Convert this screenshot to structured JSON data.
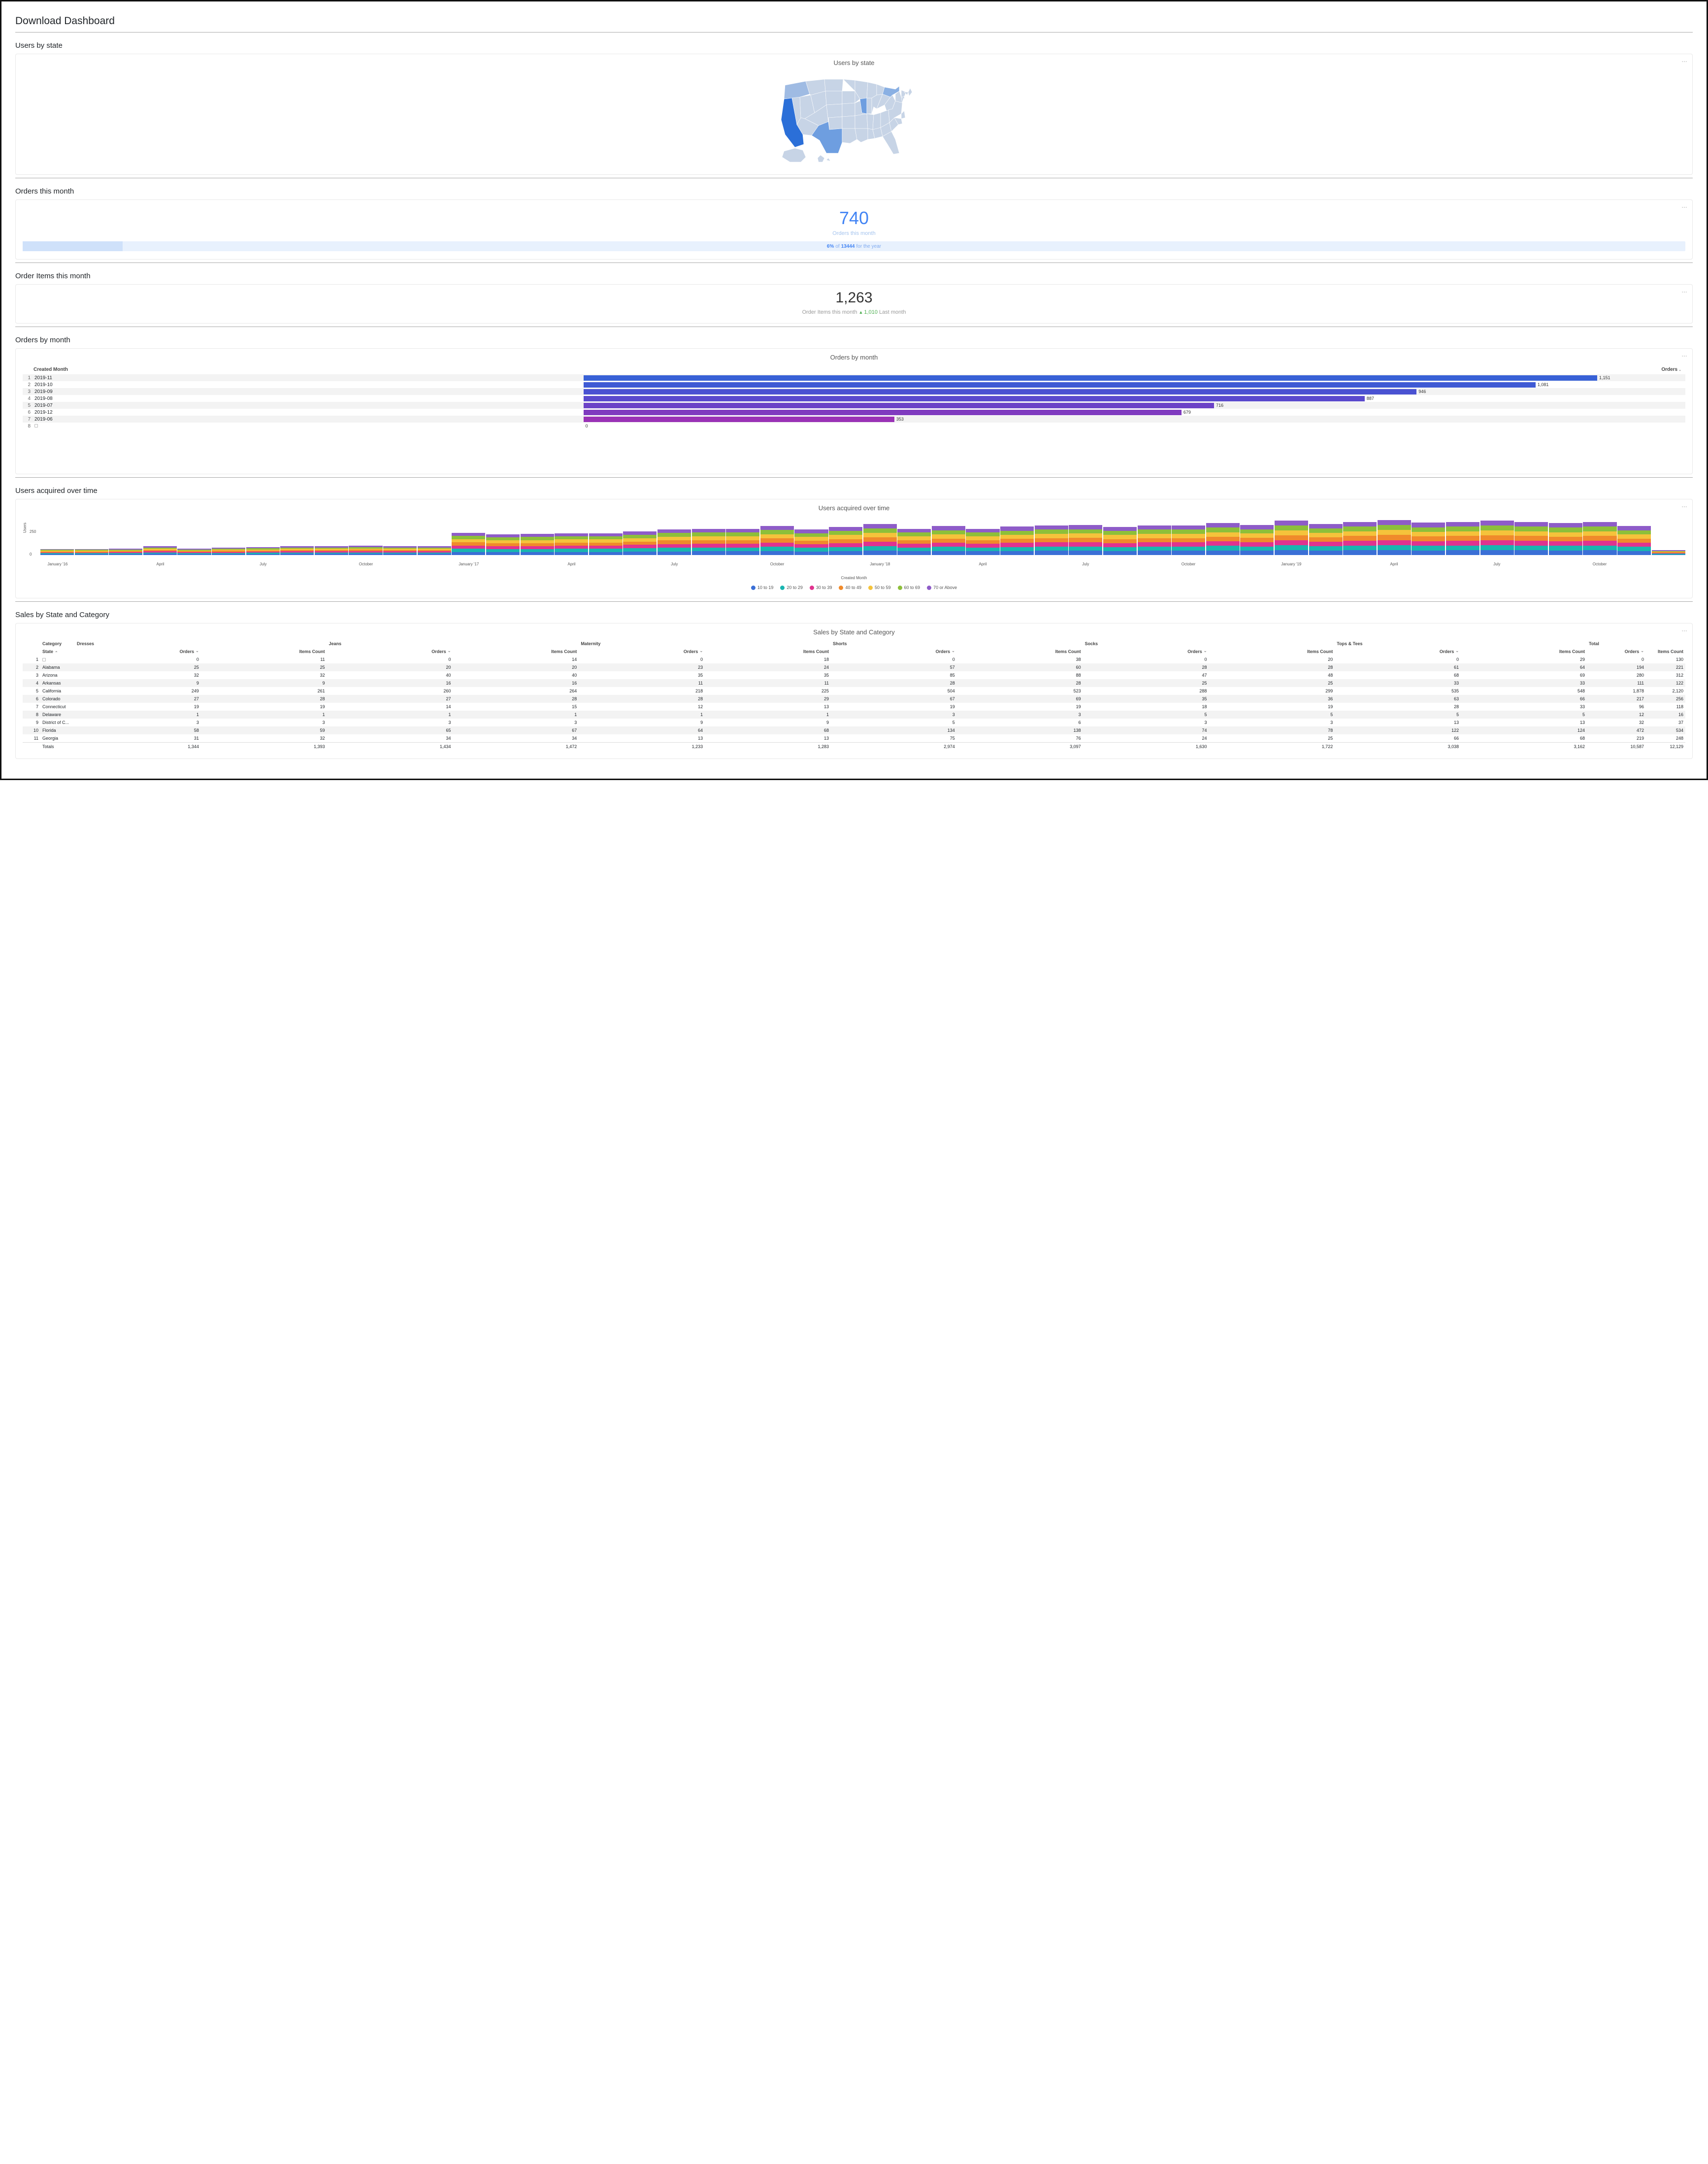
{
  "page": {
    "title": "Download Dashboard"
  },
  "sections": {
    "users_by_state": "Users by state",
    "orders_this_month": "Orders this month",
    "order_items_this_month": "Order Items this month",
    "orders_by_month": "Orders by month",
    "users_acquired_over_time": "Users acquired over time",
    "sales_by_state_category": "Sales by State and Category"
  },
  "tile_users_by_state": {
    "title": "Users by state"
  },
  "tile_orders_this_month": {
    "value": "740",
    "caption": "Orders this month",
    "progress_pct": 6,
    "progress_text_prefix": "6%",
    "progress_text_of": " of ",
    "progress_text_total": "13444",
    "progress_text_suffix": " for the year"
  },
  "tile_order_items": {
    "value": "1,263",
    "caption_prefix": "Order Items this month ",
    "delta": "1,010",
    "caption_suffix": " Last month"
  },
  "tile_orders_by_month": {
    "title": "Orders by month",
    "col_created": "Created Month",
    "col_orders": "Orders"
  },
  "tile_uat": {
    "title": "Users acquired over time",
    "ylabel": "Users",
    "xlabel": "Created Month",
    "yticks": [
      "250",
      "0"
    ],
    "legend": [
      "10 to 19",
      "20 to 29",
      "30 to 39",
      "40 to 49",
      "50 to 59",
      "60 to 69",
      "70 or Above"
    ]
  },
  "tile_sales": {
    "title": "Sales by State and Category",
    "headers": {
      "category": "Category",
      "state": "State",
      "orders": "Orders",
      "items": "Items Count",
      "total": "Total",
      "groups": [
        "Dresses",
        "Jeans",
        "Maternity",
        "Shorts",
        "Socks",
        "Tops & Tees"
      ]
    },
    "totals_label": "Totals"
  },
  "colors": {
    "series": [
      "#3b6fd6",
      "#19b5b0",
      "#e0338f",
      "#f08a2b",
      "#f5c33b",
      "#8dbf3a",
      "#8e5cc8"
    ]
  },
  "chart_data": [
    {
      "id": "users_by_state",
      "type": "choropleth-map",
      "title": "Users by state",
      "note": "US states shaded by user count; darker = more users. Prominent: California, Texas, New York, Illinois."
    },
    {
      "id": "orders_this_month_kpi",
      "type": "kpi",
      "value": 740,
      "label": "Orders this month",
      "progress": {
        "percent": 6,
        "total": 13444,
        "period": "for the year"
      }
    },
    {
      "id": "order_items_this_month_kpi",
      "type": "kpi",
      "value": 1263,
      "label": "Order Items this month",
      "comparison": {
        "direction": "up",
        "value": 1010,
        "label": "Last month"
      }
    },
    {
      "id": "orders_by_month",
      "type": "bar",
      "orientation": "horizontal",
      "title": "Orders by month",
      "xlabel": "Orders",
      "ylabel": "Created Month",
      "categories": [
        "2019-11",
        "2019-10",
        "2019-09",
        "2019-08",
        "2019-07",
        "2019-12",
        "2019-06",
        ""
      ],
      "values": [
        1151,
        1081,
        946,
        887,
        716,
        679,
        353,
        0
      ],
      "colors": [
        "#3861d6",
        "#3f5ad4",
        "#4a52d2",
        "#5a4acd",
        "#6b42c7",
        "#7f3abf",
        "#9a32b6",
        "#c22aa7"
      ]
    },
    {
      "id": "users_acquired_over_time",
      "type": "stacked-bar",
      "title": "Users acquired over time",
      "xlabel": "Created Month",
      "ylabel": "Users",
      "ylim": [
        0,
        450
      ],
      "yticks": [
        0,
        250
      ],
      "legend": [
        "10 to 19",
        "20 to 29",
        "30 to 39",
        "40 to 49",
        "50 to 59",
        "60 to 69",
        "70 or Above"
      ],
      "colors": [
        "#3b6fd6",
        "#19b5b0",
        "#e0338f",
        "#f08a2b",
        "#f5c33b",
        "#8dbf3a",
        "#8e5cc8"
      ],
      "x_tick_labels": [
        "January '16",
        "April",
        "July",
        "October",
        "January '17",
        "April",
        "July",
        "October",
        "January '18",
        "April",
        "July",
        "October",
        "January '19",
        "April",
        "July",
        "October"
      ],
      "x": [
        "2016-01",
        "2016-02",
        "2016-03",
        "2016-04",
        "2016-05",
        "2016-06",
        "2016-07",
        "2016-08",
        "2016-09",
        "2016-10",
        "2016-11",
        "2016-12",
        "2017-01",
        "2017-02",
        "2017-03",
        "2017-04",
        "2017-05",
        "2017-06",
        "2017-07",
        "2017-08",
        "2017-09",
        "2017-10",
        "2017-11",
        "2017-12",
        "2018-01",
        "2018-02",
        "2018-03",
        "2018-04",
        "2018-05",
        "2018-06",
        "2018-07",
        "2018-08",
        "2018-09",
        "2018-10",
        "2018-11",
        "2018-12",
        "2019-01",
        "2019-02",
        "2019-03",
        "2019-04",
        "2019-05",
        "2019-06",
        "2019-07",
        "2019-08",
        "2019-09",
        "2019-10",
        "2019-11",
        "2019-12"
      ],
      "totals_est": [
        70,
        70,
        75,
        100,
        75,
        85,
        90,
        100,
        100,
        105,
        100,
        100,
        255,
        235,
        240,
        250,
        250,
        270,
        295,
        300,
        300,
        335,
        290,
        320,
        355,
        300,
        330,
        300,
        325,
        340,
        345,
        320,
        340,
        340,
        365,
        345,
        395,
        355,
        380,
        400,
        370,
        380,
        395,
        380,
        365,
        380,
        330,
        55
      ],
      "note": "Totals are visual estimates. Each bar is split across 7 age buckets (see legend) roughly evenly; exact per-segment values not labeled."
    },
    {
      "id": "sales_by_state_and_category",
      "type": "table",
      "title": "Sales by State and Category",
      "columns": [
        "Category",
        "State",
        "Dresses Orders",
        "Dresses Items Count",
        "Jeans Orders",
        "Jeans Items Count",
        "Maternity Orders",
        "Maternity Items Count",
        "Shorts Orders",
        "Shorts Items Count",
        "Socks Orders",
        "Socks Items Count",
        "Tops & Tees Orders",
        "Tops & Tees Items Count",
        "Total Orders",
        "Total Items Count"
      ],
      "rows": [
        {
          "idx": 1,
          "state": "",
          "dresses": [
            0,
            11
          ],
          "jeans": [
            0,
            14
          ],
          "maternity": [
            0,
            18
          ],
          "shorts": [
            0,
            38
          ],
          "socks": [
            0,
            20
          ],
          "tops": [
            0,
            29
          ],
          "total": [
            0,
            130
          ]
        },
        {
          "idx": 2,
          "state": "Alabama",
          "dresses": [
            25,
            25
          ],
          "jeans": [
            20,
            20
          ],
          "maternity": [
            23,
            24
          ],
          "shorts": [
            57,
            60
          ],
          "socks": [
            28,
            28
          ],
          "tops": [
            61,
            64
          ],
          "total": [
            194,
            221
          ]
        },
        {
          "idx": 3,
          "state": "Arizona",
          "dresses": [
            32,
            32
          ],
          "jeans": [
            40,
            40
          ],
          "maternity": [
            35,
            35
          ],
          "shorts": [
            85,
            88
          ],
          "socks": [
            47,
            48
          ],
          "tops": [
            68,
            69
          ],
          "total": [
            280,
            312
          ]
        },
        {
          "idx": 4,
          "state": "Arkansas",
          "dresses": [
            9,
            9
          ],
          "jeans": [
            16,
            16
          ],
          "maternity": [
            11,
            11
          ],
          "shorts": [
            28,
            28
          ],
          "socks": [
            25,
            25
          ],
          "tops": [
            33,
            33
          ],
          "total": [
            111,
            122
          ]
        },
        {
          "idx": 5,
          "state": "California",
          "dresses": [
            249,
            261
          ],
          "jeans": [
            260,
            264
          ],
          "maternity": [
            218,
            225
          ],
          "shorts": [
            504,
            523
          ],
          "socks": [
            288,
            299
          ],
          "tops": [
            535,
            548
          ],
          "total": [
            1878,
            2120
          ]
        },
        {
          "idx": 6,
          "state": "Colorado",
          "dresses": [
            27,
            28
          ],
          "jeans": [
            27,
            28
          ],
          "maternity": [
            28,
            29
          ],
          "shorts": [
            67,
            69
          ],
          "socks": [
            35,
            36
          ],
          "tops": [
            63,
            66
          ],
          "total": [
            217,
            256
          ]
        },
        {
          "idx": 7,
          "state": "Connecticut",
          "dresses": [
            19,
            19
          ],
          "jeans": [
            14,
            15
          ],
          "maternity": [
            12,
            13
          ],
          "shorts": [
            19,
            19
          ],
          "socks": [
            18,
            19
          ],
          "tops": [
            28,
            33
          ],
          "total": [
            96,
            118
          ]
        },
        {
          "idx": 8,
          "state": "Delaware",
          "dresses": [
            1,
            1
          ],
          "jeans": [
            1,
            1
          ],
          "maternity": [
            1,
            1
          ],
          "shorts": [
            3,
            3
          ],
          "socks": [
            5,
            5
          ],
          "tops": [
            5,
            5
          ],
          "total": [
            12,
            16
          ]
        },
        {
          "idx": 9,
          "state": "District of C...",
          "dresses": [
            3,
            3
          ],
          "jeans": [
            3,
            3
          ],
          "maternity": [
            9,
            9
          ],
          "shorts": [
            5,
            6
          ],
          "socks": [
            3,
            3
          ],
          "tops": [
            13,
            13
          ],
          "total": [
            32,
            37
          ]
        },
        {
          "idx": 10,
          "state": "Florida",
          "dresses": [
            58,
            59
          ],
          "jeans": [
            65,
            67
          ],
          "maternity": [
            64,
            68
          ],
          "shorts": [
            134,
            138
          ],
          "socks": [
            74,
            78
          ],
          "tops": [
            122,
            124
          ],
          "total": [
            472,
            534
          ]
        },
        {
          "idx": 11,
          "state": "Georgia",
          "dresses": [
            31,
            32
          ],
          "jeans": [
            34,
            34
          ],
          "maternity": [
            13,
            13
          ],
          "shorts": [
            75,
            76
          ],
          "socks": [
            24,
            25
          ],
          "tops": [
            66,
            68
          ],
          "total": [
            219,
            248
          ]
        }
      ],
      "totals": {
        "dresses": [
          1344,
          1393
        ],
        "jeans": [
          1434,
          1472
        ],
        "maternity": [
          1233,
          1283
        ],
        "shorts": [
          2974,
          3097
        ],
        "socks": [
          1630,
          1722
        ],
        "tops": [
          3038,
          3162
        ],
        "total": [
          10587,
          12129
        ]
      }
    }
  ]
}
